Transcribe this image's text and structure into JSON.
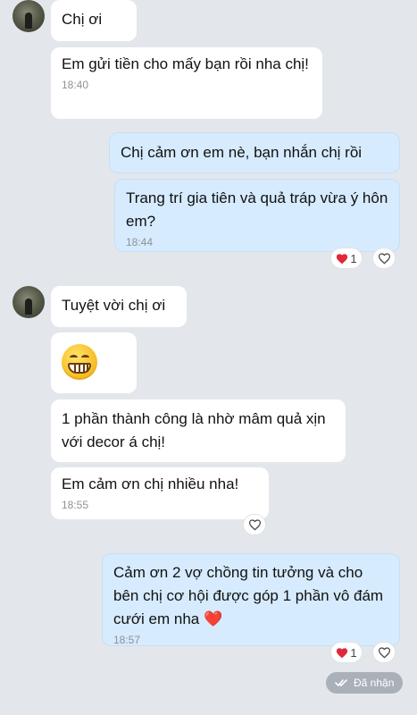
{
  "messages": {
    "m1": {
      "text": "Chị ơi"
    },
    "m2": {
      "text": "Em gửi tiền cho mấy bạn rồi nha chị!",
      "time": "18:40"
    },
    "m3": {
      "text": "Chị cảm ơn em nè, bạn nhắn chị rồi"
    },
    "m4": {
      "text": "Trang trí gia tiên và quả tráp vừa ý hôn em?",
      "time": "18:44",
      "reaction_count": "1"
    },
    "m5": {
      "text": "Tuyệt vời chị ơi"
    },
    "m6": {
      "emoji": "grinning-face-emoji"
    },
    "m7": {
      "text": "1 phần thành công là nhờ mâm quả xịn với decor á chị!"
    },
    "m8": {
      "text": "Em cảm ơn chị nhiều nha!",
      "time": "18:55"
    },
    "m9": {
      "text": "Cảm ơn 2 vợ chồng tin tưởng và cho bên chị cơ hội được góp 1 phần vô đám cưới em nha ❤️",
      "time": "18:57",
      "reaction_count": "1"
    }
  },
  "status": {
    "seen_label": "Đã nhận"
  },
  "colors": {
    "background": "#e3e7ec",
    "incoming_bubble": "#ffffff",
    "outgoing_bubble": "#d6ebfd",
    "heart": "#e0283c"
  }
}
